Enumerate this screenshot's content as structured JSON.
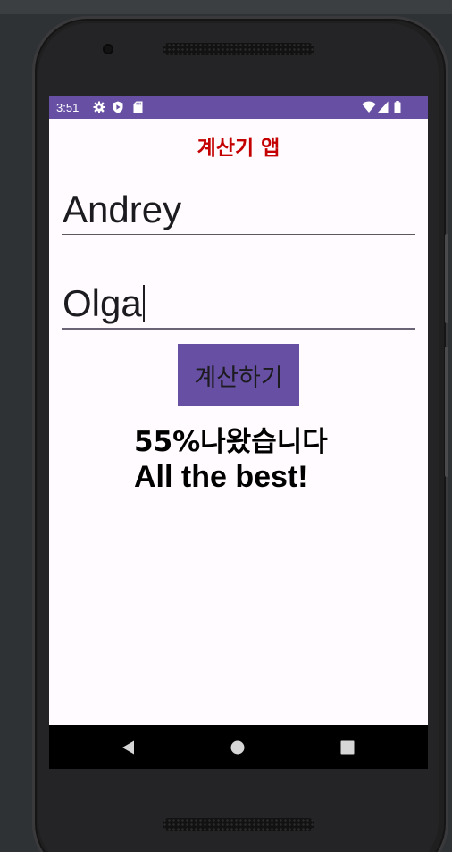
{
  "status_bar": {
    "time": "3:51",
    "left_icons": [
      "gear-icon",
      "play-shield-icon",
      "sd-card-icon"
    ],
    "right_icons": [
      "wifi-icon",
      "signal-icon",
      "battery-icon"
    ],
    "color": "#6750a4"
  },
  "app": {
    "title": "계산기 앱",
    "title_color": "#c40000"
  },
  "fields": [
    {
      "value": "Andrey",
      "focused": false
    },
    {
      "value": "Olga",
      "focused": true
    }
  ],
  "calculate_button": {
    "label": "계산하기",
    "color": "#6750a4"
  },
  "result": {
    "line1": "55%나왔습니다",
    "line2": "All the best!"
  },
  "nav_bar": {
    "buttons": [
      "back-icon",
      "home-icon",
      "recents-icon"
    ]
  }
}
